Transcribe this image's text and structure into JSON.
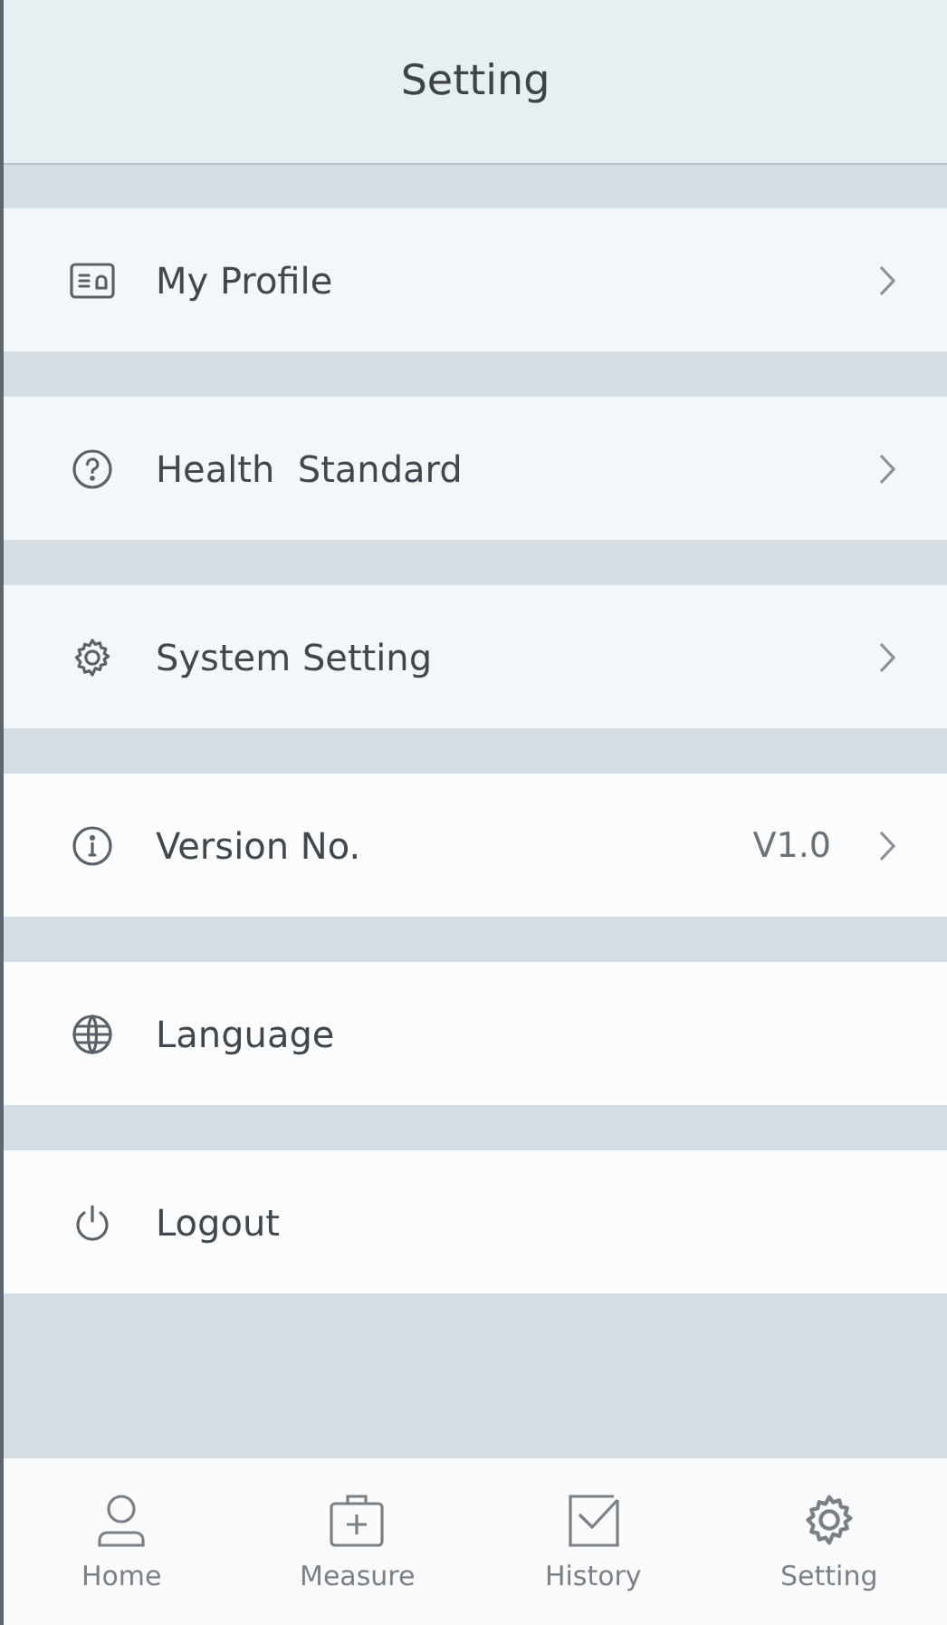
{
  "header": {
    "title": "Setting"
  },
  "menu": [
    {
      "label": "My Profile",
      "chevron": true
    },
    {
      "label": "Health  Standard",
      "chevron": true
    },
    {
      "label": "System Setting",
      "chevron": true
    },
    {
      "label": "Version No.",
      "value": "V1.0",
      "chevron": true
    },
    {
      "label": "Language",
      "chevron": false
    },
    {
      "label": "Logout",
      "chevron": false
    }
  ],
  "tab_bar": [
    {
      "label": "Home"
    },
    {
      "label": "Measure"
    },
    {
      "label": "History"
    },
    {
      "label": "Setting"
    }
  ]
}
